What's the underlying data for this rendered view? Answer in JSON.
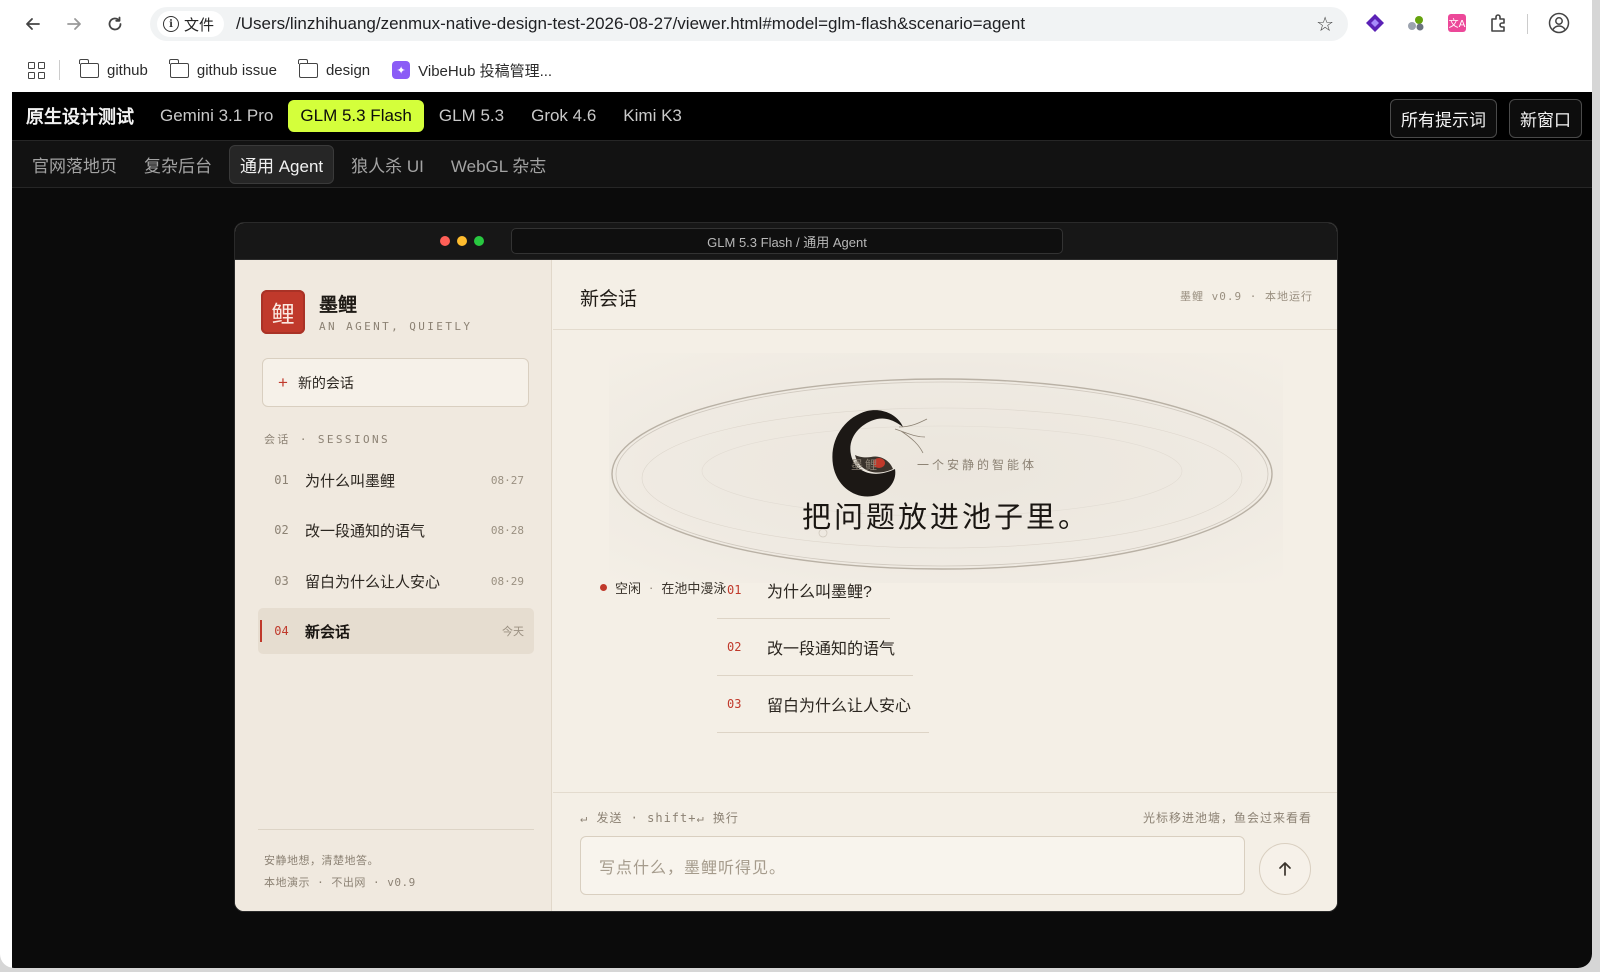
{
  "browser": {
    "scheme_label": "文件",
    "url": "/Users/linzhihuang/zenmux-native-design-test-2026-08-27/viewer.html#model=glm-flash&scenario=agent",
    "bookmarks": [
      {
        "label": "github",
        "icon": "folder-icon"
      },
      {
        "label": "github issue",
        "icon": "folder-icon"
      },
      {
        "label": "design",
        "icon": "folder-icon"
      },
      {
        "label": "VibeHub 投稿管理...",
        "icon": "vibehub-icon"
      }
    ]
  },
  "topbar": {
    "brand": "原生设计测试",
    "models": [
      {
        "label": "Gemini 3.1 Pro",
        "active": false
      },
      {
        "label": "GLM 5.3 Flash",
        "active": true
      },
      {
        "label": "GLM 5.3",
        "active": false
      },
      {
        "label": "Grok 4.6",
        "active": false
      },
      {
        "label": "Kimi K3",
        "active": false
      }
    ],
    "all_prompts_label": "所有提示词",
    "new_window_label": "新窗口",
    "accent": "#d4ff3b"
  },
  "scenarios": [
    {
      "label": "官网落地页",
      "active": false
    },
    {
      "label": "复杂后台",
      "active": false
    },
    {
      "label": "通用 Agent",
      "active": true
    },
    {
      "label": "狼人杀 UI",
      "active": false
    },
    {
      "label": "WebGL 杂志",
      "active": false
    }
  ],
  "window": {
    "title": "GLM 5.3 Flash / 通用 Agent"
  },
  "sidebar": {
    "logo_char": "鲤",
    "app_name": "墨鲤",
    "app_subtitle": "AN AGENT, QUIETLY",
    "new_session_label": "新的会话",
    "section_label": "会话 · SESSIONS",
    "sessions": [
      {
        "num": "01",
        "title": "为什么叫墨鲤",
        "date": "08·27",
        "active": false
      },
      {
        "num": "02",
        "title": "改一段通知的语气",
        "date": "08·28",
        "active": false
      },
      {
        "num": "03",
        "title": "留白为什么让人安心",
        "date": "08·29",
        "active": false
      },
      {
        "num": "04",
        "title": "新会话",
        "date": "今天",
        "active": true
      }
    ],
    "footer_line1": "安静地想，清楚地答。",
    "footer_line2": "本地演示 · 不出网 · v0.9",
    "brand_color": "#c0392b"
  },
  "main": {
    "title": "新会话",
    "meta": "墨鲤 v0.9 · 本地运行",
    "hero_overlay": "墨鲤",
    "hero_subtitle": "一个安静的智能体",
    "hero_title": "把问题放进池子里。",
    "status_idle": "空闲",
    "status_text": "在池中漫泳",
    "suggestions": [
      {
        "num": "01",
        "text": "为什么叫墨鲤?"
      },
      {
        "num": "02",
        "text": "改一段通知的语气"
      },
      {
        "num": "03",
        "text": "留白为什么让人安心"
      }
    ],
    "hint_left": "↵ 发送 · shift+↵ 换行",
    "hint_right": "光标移进池塘，鱼会过来看看",
    "input_placeholder": "写点什么，墨鲤听得见。",
    "send_icon": "arrow-up-icon"
  }
}
